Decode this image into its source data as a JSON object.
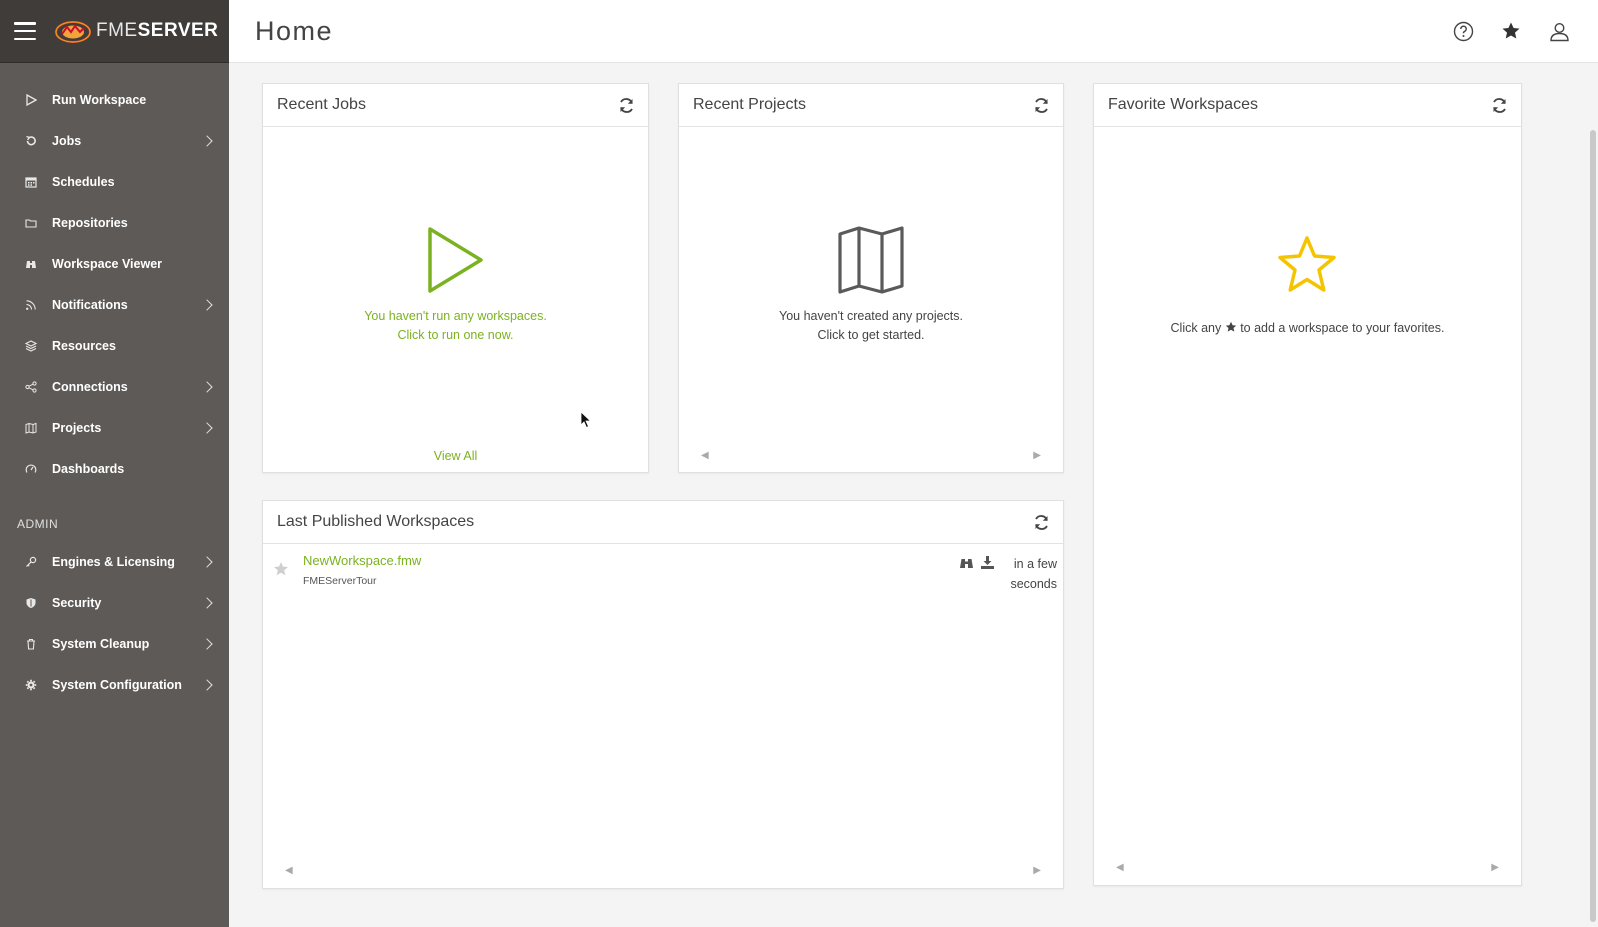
{
  "brand": {
    "fme": "FME",
    "server": "SERVER"
  },
  "header": {
    "title": "Home"
  },
  "sidebar": {
    "items": [
      {
        "label": "Run Workspace",
        "icon": "play-icon",
        "chevron": false
      },
      {
        "label": "Jobs",
        "icon": "history-icon",
        "chevron": true
      },
      {
        "label": "Schedules",
        "icon": "calendar-icon",
        "chevron": false
      },
      {
        "label": "Repositories",
        "icon": "folder-icon",
        "chevron": false
      },
      {
        "label": "Workspace Viewer",
        "icon": "binoculars-icon",
        "chevron": false
      },
      {
        "label": "Notifications",
        "icon": "rss-icon",
        "chevron": true
      },
      {
        "label": "Resources",
        "icon": "layers-icon",
        "chevron": false
      },
      {
        "label": "Connections",
        "icon": "share-icon",
        "chevron": true
      },
      {
        "label": "Projects",
        "icon": "map-icon",
        "chevron": true
      },
      {
        "label": "Dashboards",
        "icon": "gauge-icon",
        "chevron": false
      }
    ],
    "admin_label": "ADMIN",
    "admin_items": [
      {
        "label": "Engines & Licensing",
        "icon": "key-icon",
        "chevron": true
      },
      {
        "label": "Security",
        "icon": "shield-icon",
        "chevron": true
      },
      {
        "label": "System Cleanup",
        "icon": "trash-icon",
        "chevron": true
      },
      {
        "label": "System Configuration",
        "icon": "gear-icon",
        "chevron": true
      }
    ]
  },
  "cards": {
    "recent_jobs": {
      "title": "Recent Jobs",
      "message_line1": "You haven't run any workspaces.",
      "message_line2": "Click to run one now.",
      "view_all": "View All"
    },
    "recent_projects": {
      "title": "Recent Projects",
      "message_line1": "You haven't created any projects.",
      "message_line2": "Click to get started."
    },
    "favorite_workspaces": {
      "title": "Favorite Workspaces",
      "message_before": "Click any",
      "message_after": "to add a workspace to your favorites."
    },
    "last_published": {
      "title": "Last Published Workspaces",
      "items": [
        {
          "name": "NewWorkspace.fmw",
          "repository": "FMEServerTour",
          "time_line1": "in a few",
          "time_line2": "seconds"
        }
      ]
    }
  },
  "colors": {
    "accent_green": "#7bb221",
    "star_yellow": "#f5c400",
    "sidebar": "#5e5a57",
    "brand_bar": "#3f3c3a"
  }
}
